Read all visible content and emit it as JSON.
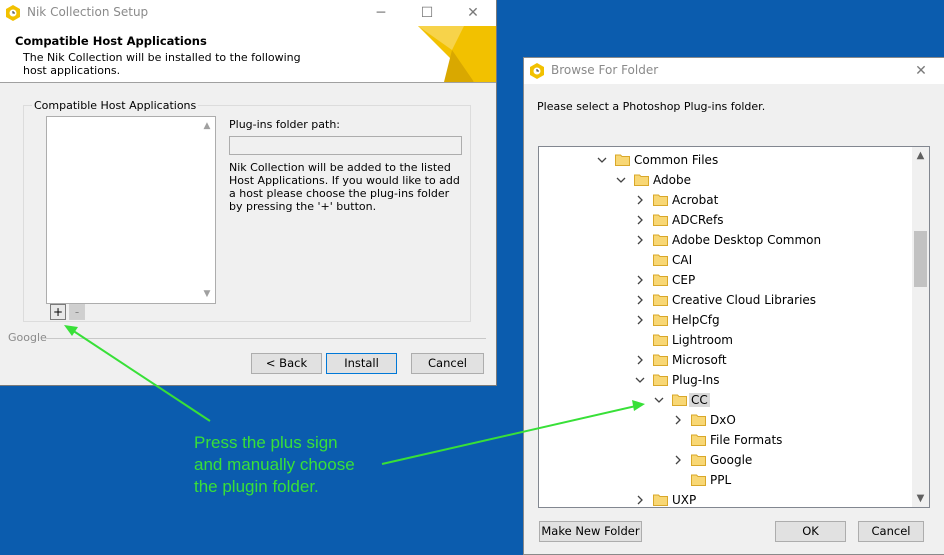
{
  "setup": {
    "title": "Nik Collection Setup",
    "header_title": "Compatible Host Applications",
    "header_subtitle": "The Nik Collection will be installed to the following host applications.",
    "group_label": "Compatible Host Applications",
    "plus_label": "+",
    "minus_label": "-",
    "plugins_path_label": "Plug-ins folder path:",
    "plugins_path_value": "",
    "description": "Nik Collection will be added to the listed Host Applications. If you would like to add a host please choose the plug-ins folder by pressing the '+' button.",
    "footer_label": "Google",
    "buttons": {
      "back": "< Back",
      "install": "Install",
      "cancel": "Cancel"
    }
  },
  "browse": {
    "title": "Browse For Folder",
    "prompt": "Please select a Photoshop Plug-ins folder.",
    "tree": [
      {
        "label": "Common Files",
        "depth": 0,
        "state": "expanded"
      },
      {
        "label": "Adobe",
        "depth": 1,
        "state": "expanded"
      },
      {
        "label": "Acrobat",
        "depth": 2,
        "state": "collapsed"
      },
      {
        "label": "ADCRefs",
        "depth": 2,
        "state": "collapsed"
      },
      {
        "label": "Adobe Desktop Common",
        "depth": 2,
        "state": "collapsed"
      },
      {
        "label": "CAI",
        "depth": 2,
        "state": "none"
      },
      {
        "label": "CEP",
        "depth": 2,
        "state": "collapsed"
      },
      {
        "label": "Creative Cloud Libraries",
        "depth": 2,
        "state": "collapsed"
      },
      {
        "label": "HelpCfg",
        "depth": 2,
        "state": "collapsed"
      },
      {
        "label": "Lightroom",
        "depth": 2,
        "state": "none"
      },
      {
        "label": "Microsoft",
        "depth": 2,
        "state": "collapsed"
      },
      {
        "label": "Plug-Ins",
        "depth": 2,
        "state": "expanded"
      },
      {
        "label": "CC",
        "depth": 3,
        "state": "expanded",
        "selected": true
      },
      {
        "label": "DxO",
        "depth": 4,
        "state": "collapsed"
      },
      {
        "label": "File Formats",
        "depth": 4,
        "state": "none"
      },
      {
        "label": "Google",
        "depth": 4,
        "state": "collapsed"
      },
      {
        "label": "PPL",
        "depth": 4,
        "state": "none"
      },
      {
        "label": "UXP",
        "depth": 2,
        "state": "collapsed"
      }
    ],
    "buttons": {
      "new_folder": "Make New Folder",
      "ok": "OK",
      "cancel": "Cancel"
    }
  },
  "annotation": {
    "lines": [
      "Press the plus sign",
      "and manually choose",
      "the plugin folder."
    ],
    "color": "#38e038"
  },
  "colors": {
    "desktop": "#0b5cae",
    "accent": "#0078d7",
    "logo": "#f2c100"
  }
}
